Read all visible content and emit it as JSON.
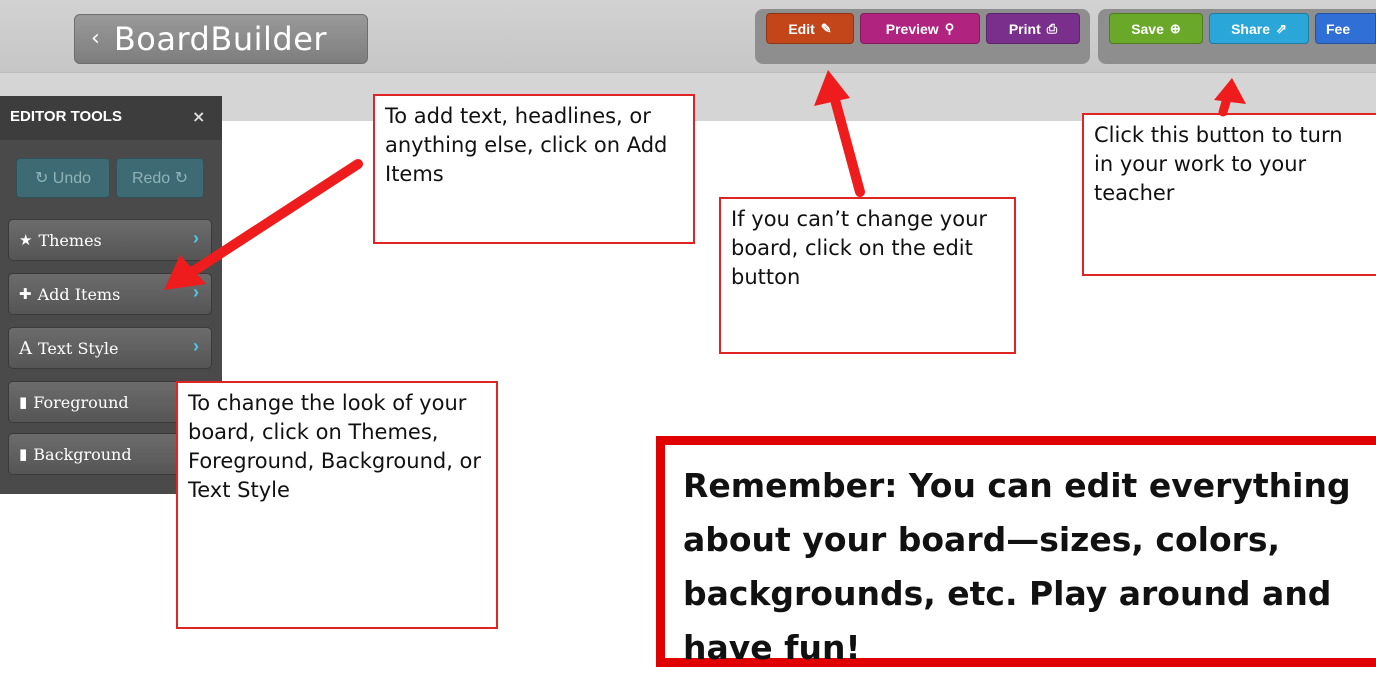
{
  "app": {
    "back_label": "‹",
    "title": "BoardBuilder"
  },
  "toolbar": {
    "edit": {
      "label": "Edit",
      "icon": "✎",
      "color": "#c2461a"
    },
    "preview": {
      "label": "Preview",
      "icon": "⚲",
      "color": "#b0237f"
    },
    "print": {
      "label": "Print",
      "icon": "⎙",
      "color": "#7a2f8c"
    },
    "save": {
      "label": "Save",
      "icon": "⊕",
      "color": "#6aa82a"
    },
    "share": {
      "label": "Share",
      "icon": "⇗",
      "color": "#2aa6d8"
    },
    "feedback": {
      "label": "Fee",
      "color": "#2f6fd6"
    }
  },
  "panel": {
    "title": "EDITOR TOOLS",
    "close": "×",
    "undo": "↻ Undo",
    "redo": "Redo ↻",
    "tools": [
      {
        "icon": "★",
        "label": "Themes",
        "chevron": "›"
      },
      {
        "icon": "✚",
        "label": "Add Items",
        "chevron": "›"
      },
      {
        "icon": "A",
        "label": "Text Style",
        "chevron": "›"
      },
      {
        "icon": "▮",
        "label": "Foreground"
      },
      {
        "icon": "▮",
        "label": "Background"
      }
    ]
  },
  "callouts": {
    "add_items": "To add text, headlines, or anything else, click on Add Items",
    "edit": "If you can’t change your board, click on the edit button",
    "share": "Click this button to turn in your work to your teacher",
    "look": "To change the look of your board, click on Themes, Foreground, Background, or Text Style",
    "remember": "Remember: You can edit everything about your board—sizes, colors, backgrounds, etc. Play around and have fun!"
  },
  "colors": {
    "arrow": "#ee1c1c",
    "callout_border": "#e02424"
  }
}
